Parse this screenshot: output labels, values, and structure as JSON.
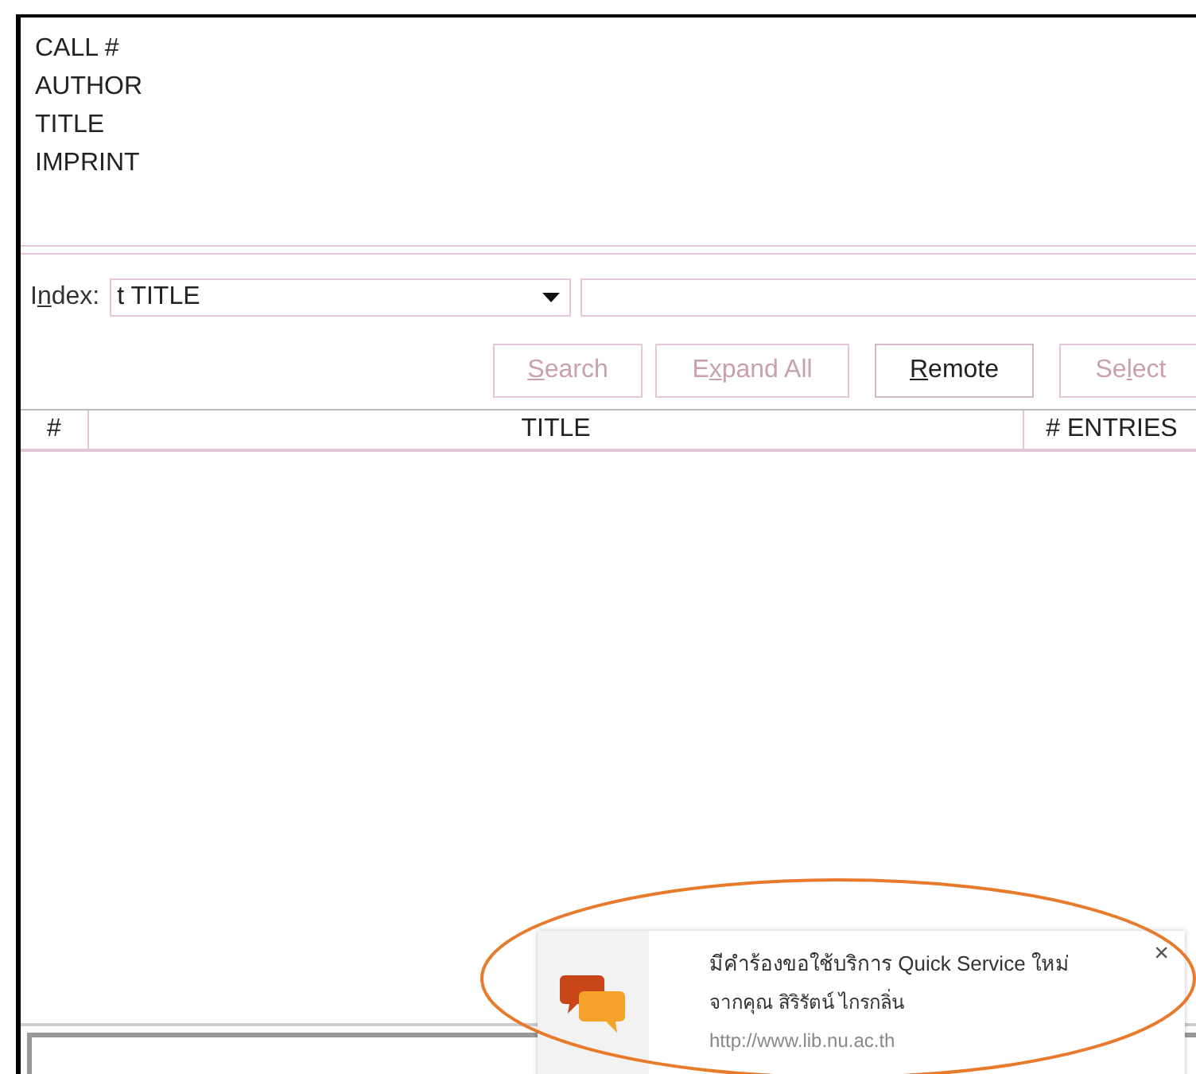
{
  "record_fields": [
    "CALL #",
    "AUTHOR",
    "TITLE",
    "IMPRINT"
  ],
  "index": {
    "label": {
      "before": "I",
      "key": "n",
      "after": "dex:"
    },
    "value": "t TITLE"
  },
  "buttons": [
    {
      "key": "S",
      "after": "earch",
      "disabled": true
    },
    {
      "before": "E",
      "key": "x",
      "after": "pand All",
      "disabled": true
    },
    {
      "key": "R",
      "after": "emote",
      "disabled": false
    },
    {
      "before": "Se",
      "key": "l",
      "after": "ect",
      "disabled": true
    }
  ],
  "table": {
    "columns": [
      "#",
      "TITLE",
      "# ENTRIES"
    ]
  },
  "notification": {
    "title": "มีคำร้องขอใช้บริการ Quick Service ใหม่",
    "message": "จากคุณ สิริรัตน์ ไกรกลิ่น",
    "source": "http://www.lib.nu.ac.th",
    "close": "×"
  }
}
